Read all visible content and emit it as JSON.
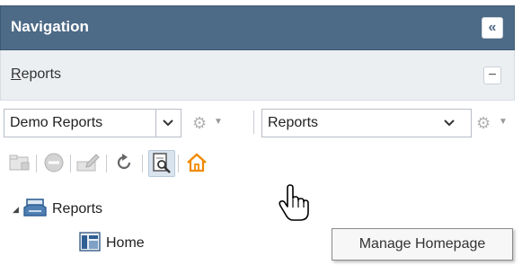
{
  "navigation": {
    "title": "Navigation",
    "collapse_icon": "double-chevron-left-icon"
  },
  "reports_section": {
    "label_first_letter": "R",
    "label_rest": "eports",
    "collapse_icon": "minus-icon"
  },
  "filters": {
    "report_set": {
      "selected": "Demo Reports"
    },
    "report_type": {
      "selected": "Reports"
    }
  },
  "toolbar": {
    "icons": [
      "new-folder-icon",
      "delete-icon",
      "edit-icon",
      "refresh-icon",
      "preview-report-icon",
      "manage-homepage-icon"
    ],
    "active": "preview-report-icon"
  },
  "tree": {
    "root": {
      "label": "Reports",
      "expanded": true,
      "icon": "reports-tray-icon"
    },
    "children": [
      {
        "label": "Home",
        "icon": "homepage-report-icon"
      }
    ]
  },
  "tooltip": {
    "text": "Manage Homepage"
  },
  "colors": {
    "titlebar": "#4d6a86",
    "section_bg": "#eceff2",
    "home_icon": "#f08a00",
    "active_button": "#d9e4ef"
  }
}
